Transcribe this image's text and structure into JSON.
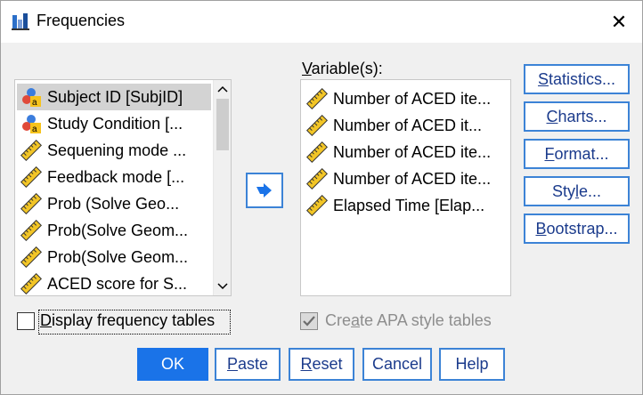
{
  "window": {
    "title": "Frequencies",
    "close_glyph": "✕"
  },
  "source_list": {
    "items": [
      {
        "label": "Subject ID [SubjID]",
        "icon": "nominal-icon",
        "selected": true
      },
      {
        "label": "Study Condition [...",
        "icon": "nominal-icon",
        "selected": false
      },
      {
        "label": "Sequening mode ...",
        "icon": "scale-ruler-icon",
        "selected": false
      },
      {
        "label": "Feedback mode [...",
        "icon": "scale-ruler-icon",
        "selected": false
      },
      {
        "label": "Prob (Solve Geo...",
        "icon": "scale-ruler-icon",
        "selected": false
      },
      {
        "label": "Prob(Solve Geom...",
        "icon": "scale-ruler-icon",
        "selected": false
      },
      {
        "label": "Prob(Solve Geom...",
        "icon": "scale-ruler-icon",
        "selected": false
      },
      {
        "label": "ACED score for S...",
        "icon": "scale-ruler-icon",
        "selected": false
      }
    ]
  },
  "target": {
    "label_prefix": "V",
    "label_rest": "ariable(s):",
    "items": [
      {
        "label": "Number of ACED ite...",
        "icon": "scale-ruler-icon"
      },
      {
        "label": "Number of ACED it...",
        "icon": "scale-ruler-icon"
      },
      {
        "label": "Number of ACED ite...",
        "icon": "scale-ruler-icon"
      },
      {
        "label": "Number of ACED ite...",
        "icon": "scale-ruler-icon"
      },
      {
        "label": "Elapsed Time [Elap...",
        "icon": "scale-ruler-icon"
      }
    ]
  },
  "side_buttons": {
    "statistics": {
      "u": "S",
      "rest": "tatistics..."
    },
    "charts": {
      "u": "C",
      "rest": "harts..."
    },
    "format": {
      "u": "F",
      "rest": "ormat..."
    },
    "style": {
      "pre": "Sty",
      "u": "l",
      "rest": "e..."
    },
    "bootstrap": {
      "u": "B",
      "rest": "ootstrap..."
    }
  },
  "display_freq": {
    "u": "D",
    "rest": "isplay frequency tables",
    "checked": false
  },
  "apa_tables": {
    "pre": "Cre",
    "u": "a",
    "rest": "te APA style tables",
    "checked": true,
    "enabled": false
  },
  "bottom_buttons": {
    "ok": "OK",
    "paste": {
      "u": "P",
      "rest": "aste"
    },
    "reset": {
      "u": "R",
      "rest": "eset"
    },
    "cancel": "Cancel",
    "help": "Help"
  },
  "colors": {
    "accent": "#1a73e8",
    "border_blue": "#3c83d6",
    "selection": "#d3d3d3"
  }
}
